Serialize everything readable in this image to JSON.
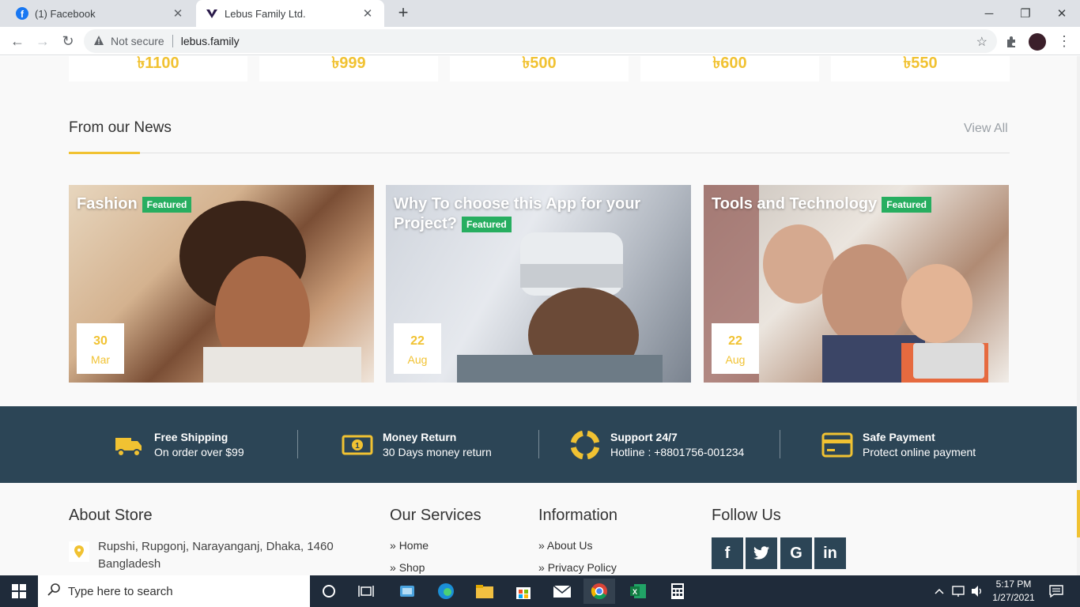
{
  "browser": {
    "tabs": [
      {
        "title": "(1) Facebook"
      },
      {
        "title": "Lebus Family Ltd."
      }
    ],
    "security_label": "Not secure",
    "url": "lebus.family"
  },
  "prices": [
    "৳1100",
    "৳999",
    "৳500",
    "৳600",
    "৳550"
  ],
  "news": {
    "title": "From our News",
    "view_all": "View All",
    "badge": "Featured",
    "items": [
      {
        "title": "Fashion",
        "day": "30",
        "month": "Mar"
      },
      {
        "title": "Why To choose this App for your Project?",
        "day": "22",
        "month": "Aug"
      },
      {
        "title": "Tools and Technology",
        "day": "22",
        "month": "Aug"
      }
    ]
  },
  "features": [
    {
      "title": "Free Shipping",
      "subtitle": "On order over $99",
      "icon": "truck-icon"
    },
    {
      "title": "Money Return",
      "subtitle": "30 Days money return",
      "icon": "money-icon"
    },
    {
      "title": "Support 24/7",
      "subtitle": "Hotline : +8801756-001234",
      "icon": "lifebuoy-icon"
    },
    {
      "title": "Safe Payment",
      "subtitle": "Protect online payment",
      "icon": "credit-card-icon"
    }
  ],
  "footer": {
    "about": {
      "heading": "About Store",
      "address": "Rupshi, Rupgonj, Narayanganj, Dhaka, 1460 Bangladesh"
    },
    "services": {
      "heading": "Our Services",
      "links": [
        "Home",
        "Shop"
      ]
    },
    "information": {
      "heading": "Information",
      "links": [
        "About Us",
        "Privacy Policy"
      ]
    },
    "follow": {
      "heading": "Follow Us",
      "networks": [
        "f",
        "t",
        "G",
        "in"
      ]
    }
  },
  "taskbar": {
    "search_placeholder": "Type here to search",
    "time": "5:17 PM",
    "date": "1/27/2021"
  },
  "colors": {
    "accent": "#f1c232",
    "dark": "#2c4556",
    "badge": "#27ae60"
  }
}
